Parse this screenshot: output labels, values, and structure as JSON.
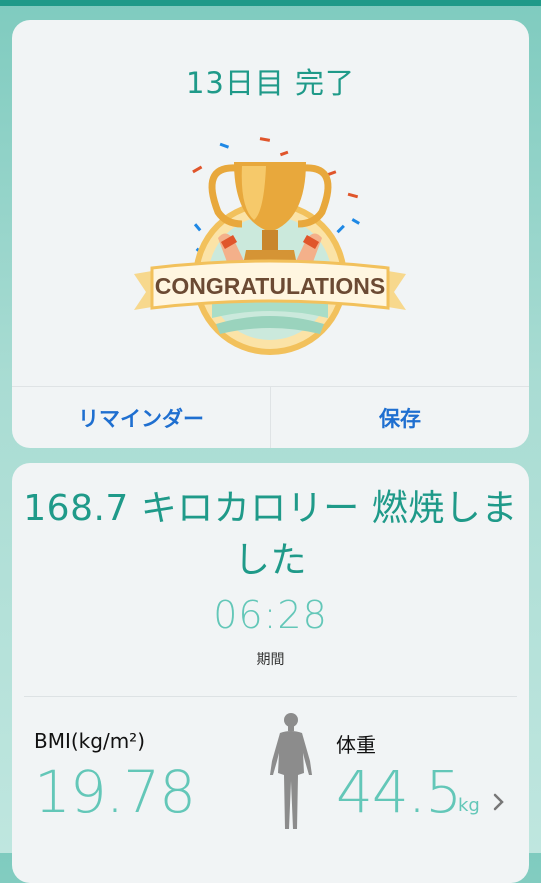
{
  "result": {
    "title": "13日目 完了",
    "badge_text": "CONGRATULATIONS",
    "buttons": {
      "reminder": "リマインダー",
      "save": "保存"
    }
  },
  "stats": {
    "burn_title": "168.7 キロカロリー 燃焼しました",
    "duration_value": "06:28",
    "duration_label": "期間",
    "bmi_label": "BMI(kg/m²)",
    "bmi_value": "19.78",
    "weight_label": "体重",
    "weight_value": "44.5",
    "weight_unit": "kg"
  },
  "colors": {
    "accent": "#1f9a89",
    "accent_light": "#63c7b8",
    "link_blue": "#1f6fd0"
  },
  "icons": [
    "trophy-badge-icon",
    "body-figure-icon",
    "chevron-right-icon"
  ]
}
